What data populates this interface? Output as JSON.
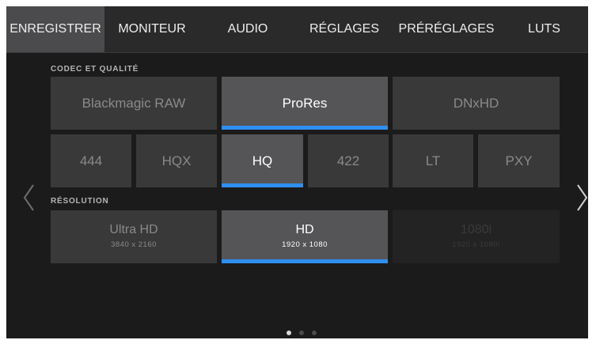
{
  "tabs": [
    {
      "label": "ENREGISTRER",
      "active": true
    },
    {
      "label": "MONITEUR",
      "active": false
    },
    {
      "label": "AUDIO",
      "active": false
    },
    {
      "label": "RÉGLAGES",
      "active": false
    },
    {
      "label": "PRÉRÉGLAGES",
      "active": false
    },
    {
      "label": "LUTS",
      "active": false
    }
  ],
  "codec": {
    "section_label": "CODEC ET QUALITÉ",
    "options": [
      "Blackmagic RAW",
      "ProRes",
      "DNxHD"
    ],
    "selected": "ProRes"
  },
  "quality": {
    "options": [
      "444",
      "HQX",
      "HQ",
      "422",
      "LT",
      "PXY"
    ],
    "selected": "HQ"
  },
  "resolution": {
    "section_label": "RÉSOLUTION",
    "options": [
      {
        "label": "Ultra HD",
        "sub": "3840 x 2160",
        "state": "normal"
      },
      {
        "label": "HD",
        "sub": "1920 x 1080",
        "state": "selected"
      },
      {
        "label": "1080i",
        "sub": "1920 x 1080i",
        "state": "disabled"
      }
    ]
  },
  "navigation": {
    "prev_icon": "chevron-left-icon",
    "next_icon": "chevron-right-icon"
  },
  "pagination": {
    "page_count": 3,
    "current_page": 1
  },
  "colors": {
    "accent": "#2f8ff0",
    "selected_bg": "#555557",
    "tile_bg": "#393939",
    "screen_bg": "#1b1b1c"
  }
}
